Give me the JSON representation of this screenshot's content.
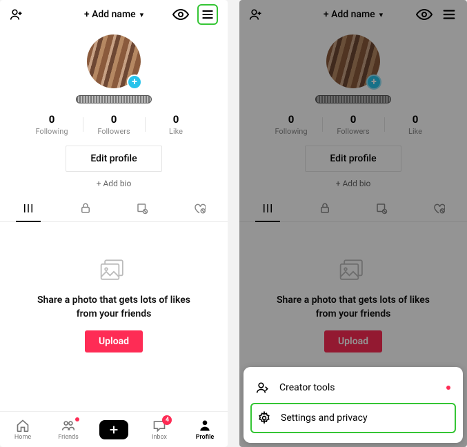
{
  "header": {
    "add_name_label": "+ Add name"
  },
  "profile": {
    "stats": [
      {
        "count": "0",
        "label": "Following"
      },
      {
        "count": "0",
        "label": "Followers"
      },
      {
        "count": "0",
        "label": "Like"
      }
    ],
    "edit_label": "Edit profile",
    "add_bio_label": "+ Add bio"
  },
  "empty_state": {
    "text": "Share a photo that gets lots of likes from your friends",
    "upload_label": "Upload"
  },
  "bottom_nav": {
    "home": "Home",
    "friends": "Friends",
    "inbox": "Inbox",
    "inbox_badge": "4",
    "profile": "Profile"
  },
  "sheet": {
    "creator_tools": "Creator tools",
    "settings_privacy": "Settings and privacy"
  },
  "colors": {
    "accent": "#fe2c55",
    "highlight": "#34c534",
    "avatar_plus": "#28c3eb"
  }
}
